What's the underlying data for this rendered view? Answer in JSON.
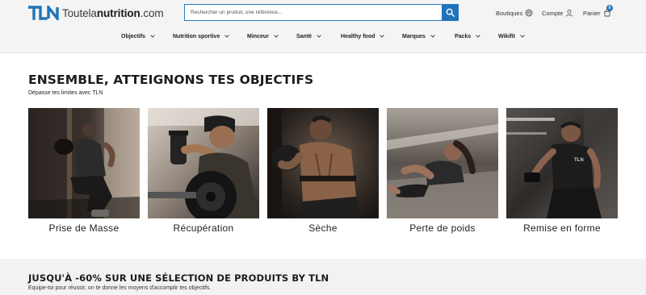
{
  "header": {
    "logo_text_light": "Toutela",
    "logo_text_bold": "nutrition",
    "logo_text_suffix": ".com",
    "search_placeholder": "Rechercher un produit, une référence...",
    "boutiques_label": "Boutiques",
    "compte_label": "Compte",
    "panier_label": "Panier",
    "cart_count": "0"
  },
  "nav": {
    "items": [
      {
        "label": "Objectifs"
      },
      {
        "label": "Nutrition sportive"
      },
      {
        "label": "Minceur"
      },
      {
        "label": "Santé"
      },
      {
        "label": "Healthy food"
      },
      {
        "label": "Marques"
      },
      {
        "label": "Packs"
      },
      {
        "label": "Wikifit"
      }
    ]
  },
  "goals": {
    "title": "ENSEMBLE, ATTEIGNONS TES OBJECTIFS",
    "subtitle": "Dépasse tes limites avec TLN",
    "cards": [
      {
        "label": "Prise de Masse"
      },
      {
        "label": "Récupération"
      },
      {
        "label": "Sèche"
      },
      {
        "label": "Perte de poids"
      },
      {
        "label": "Remise en forme"
      }
    ]
  },
  "promo": {
    "title": "JUSQU'À -60% SUR UNE SÉLECTION DE PRODUITS BY TLN",
    "subtitle": "Equipe-toi pour réussir, on te donne les moyens d'accomplir tes objectifs."
  },
  "colors": {
    "brand_blue": "#1f74b9",
    "header_bg": "#f4f4f5",
    "promo_bg": "#f2f2f3"
  }
}
